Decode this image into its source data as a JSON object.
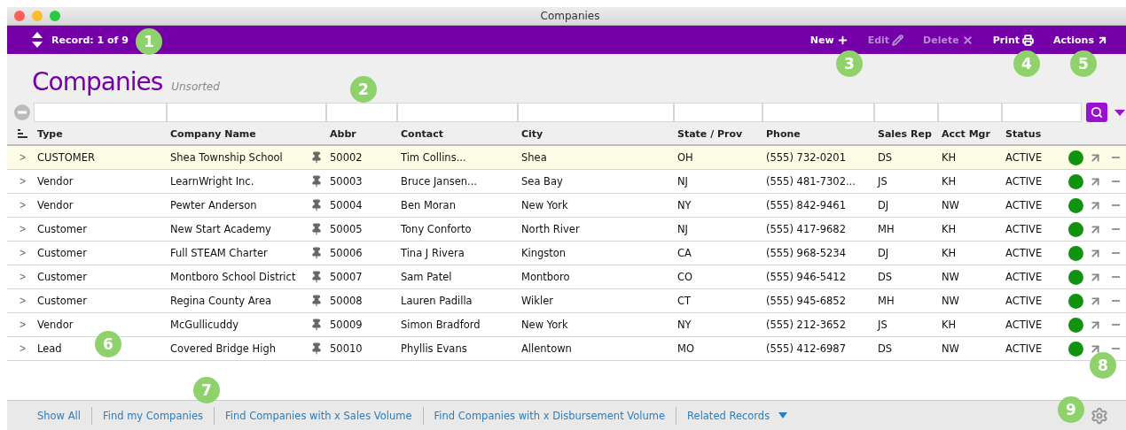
{
  "window": {
    "title": "Companies"
  },
  "toolbar": {
    "record": "Record: 1 of 9",
    "buttons": [
      {
        "kind": "new",
        "label": "New",
        "disabled": false
      },
      {
        "kind": "edit",
        "label": "Edit",
        "disabled": true
      },
      {
        "kind": "delete",
        "label": "Delete",
        "disabled": true
      },
      {
        "kind": "print",
        "label": "Print",
        "disabled": false
      },
      {
        "kind": "actions",
        "label": "Actions",
        "disabled": false
      }
    ]
  },
  "heading": {
    "title": "Companies",
    "sort": "Unsorted"
  },
  "table": {
    "columns": [
      "Type",
      "Company Name",
      "Abbr",
      "Contact",
      "City",
      "State / Prov",
      "Phone",
      "Sales Rep",
      "Acct Mgr",
      "Status"
    ],
    "rows": [
      {
        "selected": true,
        "expander": ">",
        "cells": [
          "CUSTOMER",
          "Shea Township School",
          "50002",
          "Tim Collins...",
          "Shea",
          "OH",
          "(555) 732-0201",
          "DS",
          "KH",
          "ACTIVE"
        ]
      },
      {
        "selected": false,
        "expander": ">",
        "cells": [
          "Vendor",
          "LearnWright Inc.",
          "50003",
          "Bruce Jansen...",
          "Sea Bay",
          "NJ",
          "(555) 481-7302...",
          "JS",
          "KH",
          "ACTIVE"
        ]
      },
      {
        "selected": false,
        "expander": ">",
        "cells": [
          "Vendor",
          "Pewter Anderson",
          "50004",
          "Ben Moran",
          "New York",
          "NY",
          "(555) 842-9461",
          "DJ",
          "NW",
          "ACTIVE"
        ]
      },
      {
        "selected": false,
        "expander": ">",
        "cells": [
          "Customer",
          "New Start Academy",
          "50005",
          "Tony Conforto",
          "North River",
          "NJ",
          "(555) 417-9682",
          "MH",
          "KH",
          "ACTIVE"
        ]
      },
      {
        "selected": false,
        "expander": ">",
        "cells": [
          "Customer",
          "Full STEAM Charter",
          "50006",
          "Tina J Rivera",
          "Kingston",
          "CA",
          "(555) 968-5234",
          "DJ",
          "KH",
          "ACTIVE"
        ]
      },
      {
        "selected": false,
        "expander": ">",
        "cells": [
          "Customer",
          "Montboro School District",
          "50007",
          "Sam Patel",
          "Montboro",
          "CO",
          "(555) 946-5412",
          "DS",
          "NW",
          "ACTIVE"
        ]
      },
      {
        "selected": false,
        "expander": ">",
        "cells": [
          "Customer",
          "Regina County Area",
          "50008",
          "Lauren Padilla",
          "Wikler",
          "CT",
          "(555) 945-6852",
          "MH",
          "NW",
          "ACTIVE"
        ]
      },
      {
        "selected": false,
        "expander": ">",
        "cells": [
          "Vendor",
          "McGullicuddy",
          "50009",
          "Simon Bradford",
          "New York",
          "NY",
          "(555) 212-3652",
          "JS",
          "KH",
          "ACTIVE"
        ]
      },
      {
        "selected": false,
        "expander": ">",
        "cells": [
          "Lead",
          "Covered Bridge High",
          "50010",
          "Phyllis Evans",
          "Allentown",
          "MO",
          "(555) 412-6987",
          "DS",
          "NW",
          "ACTIVE"
        ]
      }
    ]
  },
  "footer": {
    "links": [
      "Show All",
      "Find my Companies",
      "Find Companies with x Sales Volume",
      "Find Companies with x Disbursement Volume",
      "Related Records"
    ]
  },
  "callouts": [
    "1",
    "2",
    "3",
    "4",
    "5",
    "6",
    "7",
    "8",
    "9"
  ]
}
